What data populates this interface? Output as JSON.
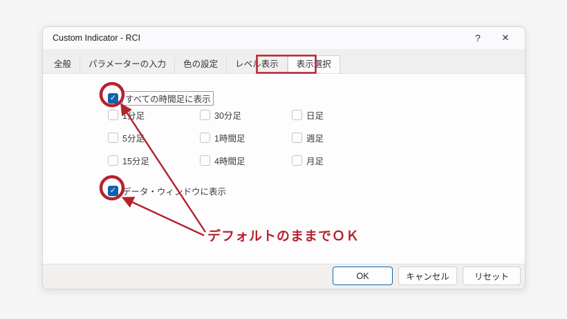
{
  "window": {
    "title": "Custom Indicator - RCI"
  },
  "icons": {
    "help": "?",
    "close": "✕",
    "check": "✓"
  },
  "tabs": [
    {
      "label": "全般",
      "active": false
    },
    {
      "label": "パラメーターの入力",
      "active": false
    },
    {
      "label": "色の設定",
      "active": false
    },
    {
      "label": "レベル表示",
      "active": false
    },
    {
      "label": "表示選択",
      "active": true,
      "annotated": true
    }
  ],
  "checkboxes": {
    "show_all_timeframes": {
      "label": "すべての時間足に表示",
      "checked": true
    },
    "timeframes": [
      {
        "label": "1分足",
        "checked": false
      },
      {
        "label": "30分足",
        "checked": false
      },
      {
        "label": "日足",
        "checked": false
      },
      {
        "label": "5分足",
        "checked": false
      },
      {
        "label": "1時間足",
        "checked": false
      },
      {
        "label": "週足",
        "checked": false
      },
      {
        "label": "15分足",
        "checked": false
      },
      {
        "label": "4時間足",
        "checked": false
      },
      {
        "label": "月足",
        "checked": false
      }
    ],
    "show_in_data_window": {
      "label": "データ・ウィンドウに表示",
      "checked": true
    }
  },
  "annotation": {
    "text": "デフォルトのままでＯＫ",
    "color": "#b5222f"
  },
  "footer": {
    "ok": "OK",
    "cancel": "キャンセル",
    "reset": "リセット"
  },
  "colors": {
    "accent_blue": "#0f62ae",
    "annotation_red": "#b5222f",
    "dialog_bg": "#fdfdfd",
    "titlebar_bg": "#fafafd"
  }
}
